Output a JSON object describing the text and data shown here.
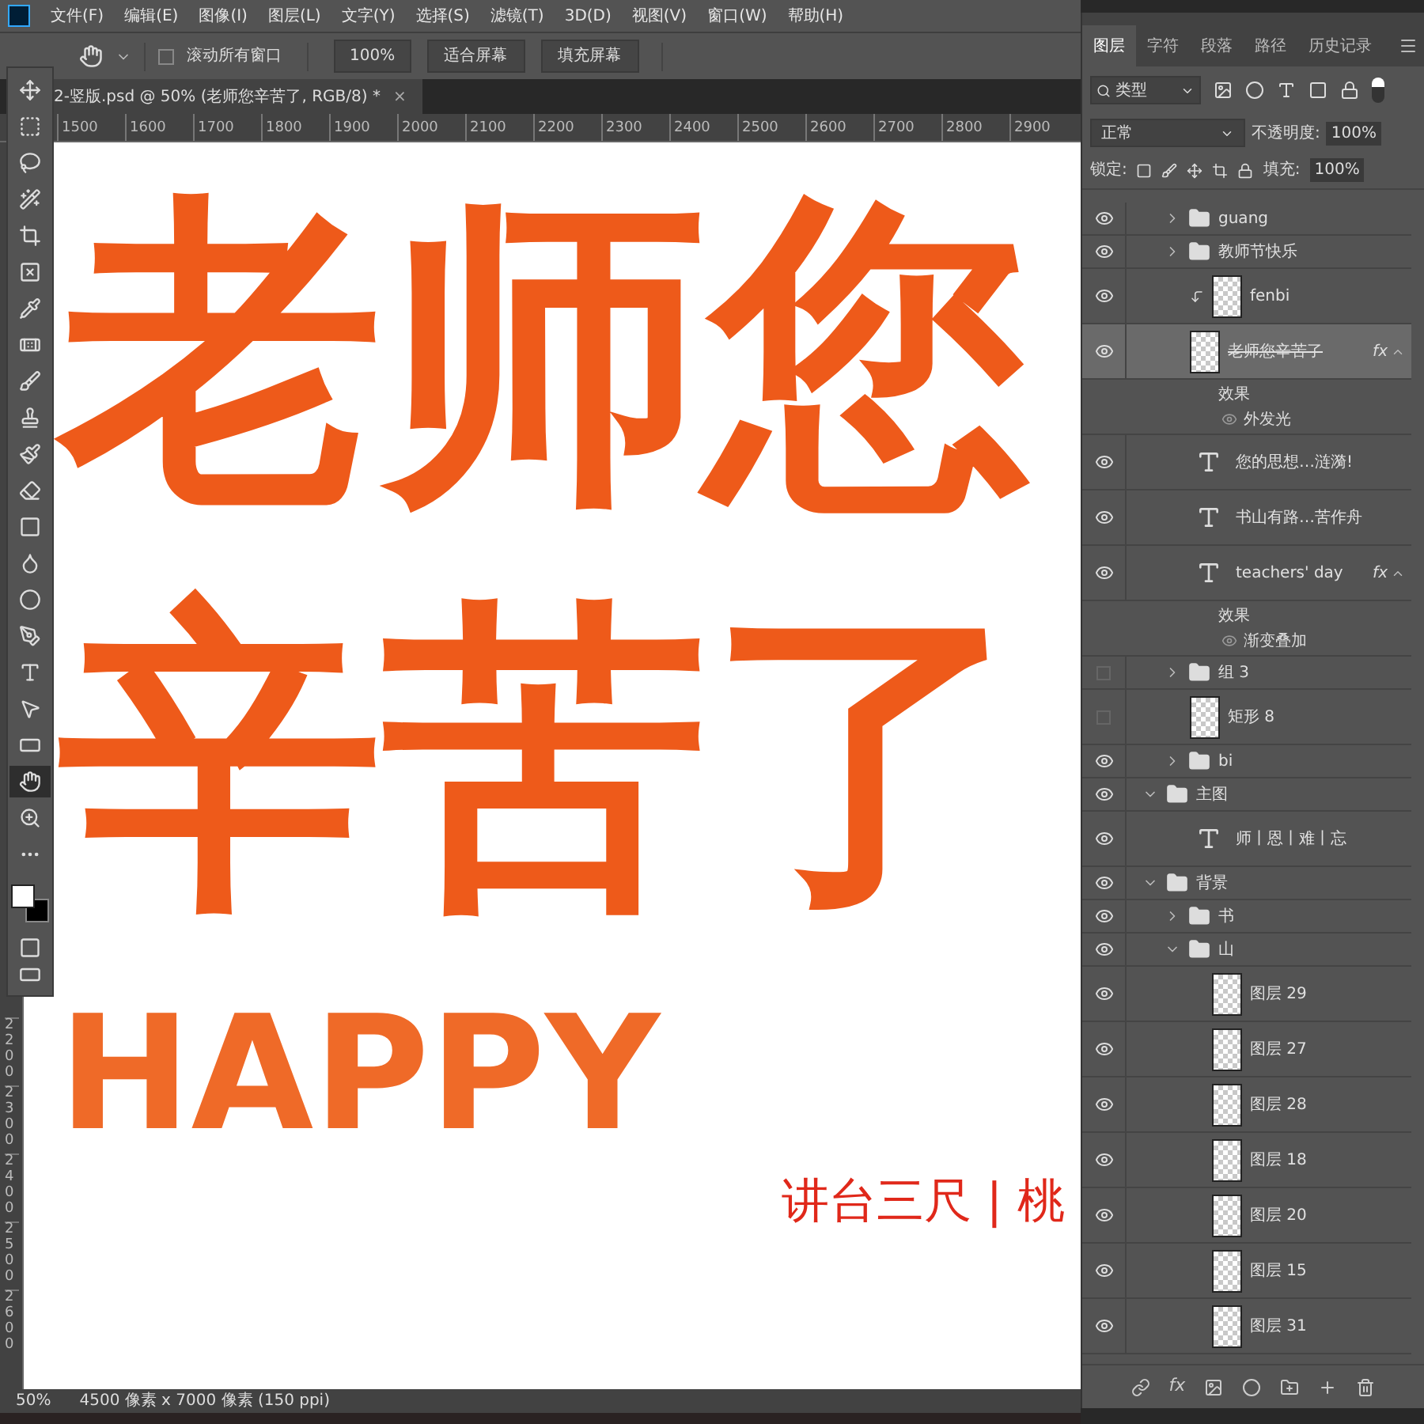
{
  "menu_bar": {
    "items": [
      "文件(F)",
      "编辑(E)",
      "图像(I)",
      "图层(L)",
      "文字(Y)",
      "选择(S)",
      "滤镜(T)",
      "3D(D)",
      "视图(V)",
      "窗口(W)",
      "帮助(H)"
    ]
  },
  "options_bar": {
    "scroll_all": {
      "label": "滚动所有窗口",
      "checked": false
    },
    "zoom_value": "100%",
    "buttons": [
      "适合屏幕",
      "填充屏幕"
    ]
  },
  "document_tab": {
    "title": "2-竖版.psd @ 50% (老师您辛苦了, RGB/8) *",
    "close": "×"
  },
  "ruler": {
    "horizontal": [
      "1500",
      "1600",
      "1700",
      "1800",
      "1900",
      "2000",
      "2100",
      "2200",
      "2300",
      "2400",
      "2500",
      "2600",
      "2700",
      "2800",
      "2900"
    ],
    "vertical": [
      "2200",
      "2300",
      "2400",
      "2500",
      "2600"
    ]
  },
  "canvas": {
    "title_row_1": "老师您",
    "title_row_2": "辛苦了",
    "happy": "HAPPY",
    "subtitle": "讲台三尺 | 桃"
  },
  "tools": [
    {
      "selected": false
    },
    {
      "selected": false
    },
    {
      "selected": false
    },
    {
      "selected": false
    },
    {
      "selected": false
    },
    {
      "selected": false
    },
    {
      "selected": false
    },
    {
      "selected": false
    },
    {
      "selected": false
    },
    {
      "selected": false
    },
    {
      "selected": false
    },
    {
      "selected": false
    },
    {
      "selected": false
    },
    {
      "selected": false
    },
    {
      "selected": false
    },
    {
      "selected": false
    },
    {
      "selected": false
    },
    {
      "selected": false
    },
    {
      "selected": false
    },
    {
      "selected": true
    },
    {
      "selected": false
    },
    {
      "selected": false
    }
  ],
  "layers_panel": {
    "tabs": [
      {
        "label": "图层",
        "selected": true
      },
      {
        "label": "字符",
        "selected": false
      },
      {
        "label": "段落",
        "selected": false
      },
      {
        "label": "路径",
        "selected": false
      },
      {
        "label": "历史记录",
        "selected": false
      }
    ],
    "footer_fx": "fx",
    "filter": "类型",
    "blend_mode": "正常",
    "opacity_label": "不透明度:",
    "opacity": "100%",
    "lock_label": "锁定:",
    "fill_label": "填充:",
    "fill": "100%",
    "open_group_children": [
      {
        "kind": "folder",
        "name": "guang",
        "visible": true,
        "expanded": false,
        "selected": false
      },
      {
        "kind": "folder",
        "name": "教师节快乐",
        "visible": true,
        "expanded": false,
        "selected": false
      },
      {
        "kind": "image",
        "name": "fenbi",
        "visible": true,
        "clipped": true,
        "selected": false
      },
      {
        "kind": "image",
        "name": "老师您辛苦了",
        "visible": true,
        "selected": true,
        "struck": true,
        "fx": "fx",
        "effects_label": "效果",
        "effects": [
          "外发光"
        ]
      },
      {
        "kind": "text",
        "name": "您的思想…涟漪!",
        "visible": true,
        "selected": false
      },
      {
        "kind": "text",
        "name": "书山有路…苦作舟",
        "visible": true,
        "selected": false
      },
      {
        "kind": "text",
        "name": "teachers' day",
        "visible": true,
        "selected": false,
        "fx": "fx",
        "effects_label": "效果",
        "effects": [
          "渐变叠加"
        ]
      },
      {
        "kind": "folder",
        "name": "组 3",
        "visible": false,
        "expanded": false,
        "selected": false
      },
      {
        "kind": "image",
        "name": "矩形 8",
        "visible": false,
        "selected": false
      },
      {
        "kind": "folder",
        "name": "bi",
        "visible": true,
        "expanded": false,
        "selected": false
      }
    ],
    "layers": [
      {
        "kind": "folder",
        "name": "主图",
        "visible": true,
        "expanded": true,
        "selected": false,
        "children": [
          {
            "kind": "text",
            "name": "师丨恩丨难丨忘",
            "visible": true,
            "selected": false
          }
        ]
      },
      {
        "kind": "folder",
        "name": "背景",
        "visible": true,
        "expanded": true,
        "selected": false,
        "children": [
          {
            "kind": "folder",
            "name": "书",
            "visible": true,
            "expanded": false,
            "selected": false
          },
          {
            "kind": "folder",
            "name": "山",
            "visible": true,
            "expanded": true,
            "selected": false,
            "children": [
              {
                "kind": "image",
                "name": "图层 29",
                "visible": true,
                "selected": false
              },
              {
                "kind": "image",
                "name": "图层 27",
                "visible": true,
                "selected": false
              },
              {
                "kind": "image",
                "name": "图层 28",
                "visible": true,
                "selected": false
              },
              {
                "kind": "image",
                "name": "图层 18",
                "visible": true,
                "selected": false
              },
              {
                "kind": "image",
                "name": "图层 20",
                "visible": true,
                "selected": false
              },
              {
                "kind": "image",
                "name": "图层 15",
                "visible": true,
                "selected": false
              },
              {
                "kind": "image",
                "name": "图层 31",
                "visible": true,
                "selected": false
              }
            ]
          }
        ]
      }
    ]
  },
  "status_bar": {
    "zoom": "50%",
    "doc_size": "4500 像素 x 7000 像素 (150 ppi)"
  }
}
